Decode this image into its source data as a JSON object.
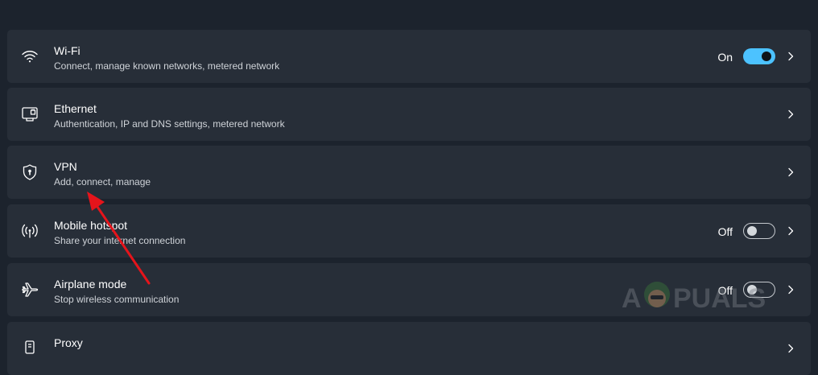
{
  "items": [
    {
      "title": "Wi-Fi",
      "subtitle": "Connect, manage known networks, metered network",
      "icon": "wifi-icon",
      "toggle": {
        "label": "On",
        "state": "on"
      }
    },
    {
      "title": "Ethernet",
      "subtitle": "Authentication, IP and DNS settings, metered network",
      "icon": "ethernet-icon"
    },
    {
      "title": "VPN",
      "subtitle": "Add, connect, manage",
      "icon": "vpn-shield-icon"
    },
    {
      "title": "Mobile hotspot",
      "subtitle": "Share your internet connection",
      "icon": "hotspot-icon",
      "toggle": {
        "label": "Off",
        "state": "off"
      }
    },
    {
      "title": "Airplane mode",
      "subtitle": "Stop wireless communication",
      "icon": "airplane-icon",
      "toggle": {
        "label": "Off",
        "state": "off"
      }
    },
    {
      "title": "Proxy",
      "subtitle": "",
      "icon": "proxy-icon"
    }
  ],
  "watermark": {
    "text": "APPUALS"
  },
  "annotation": {
    "color": "#e5141b"
  },
  "colors": {
    "accent": "#4cc2ff",
    "card_bg": "#272e38",
    "page_bg": "#1c232d"
  }
}
